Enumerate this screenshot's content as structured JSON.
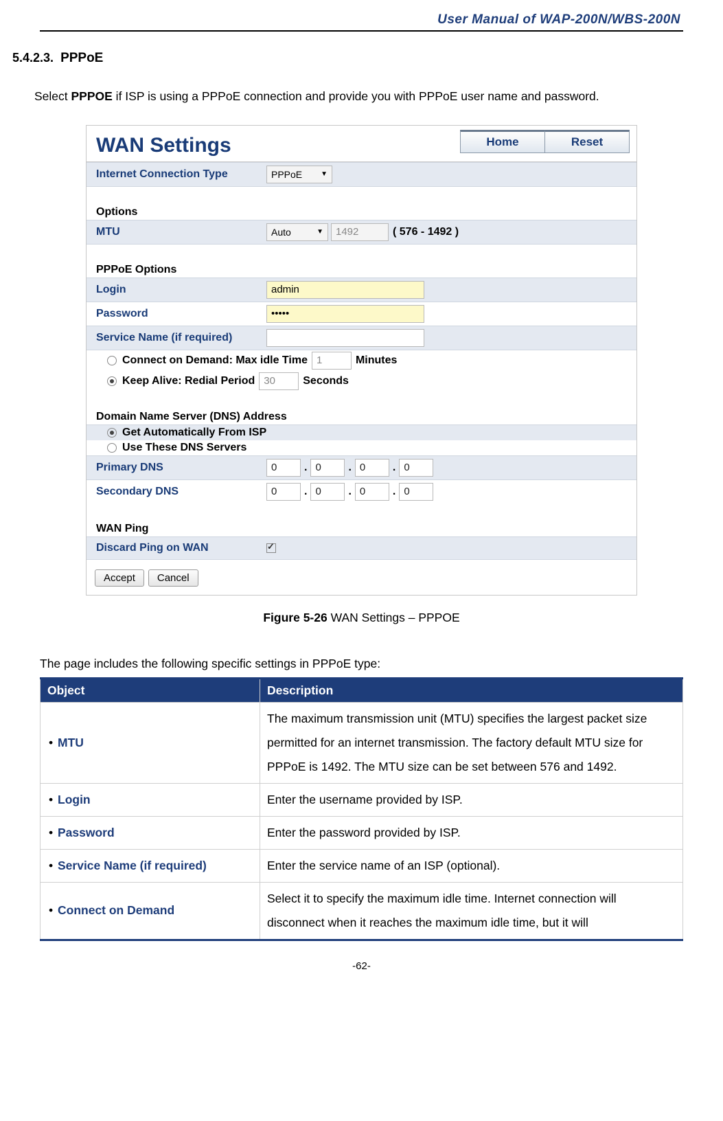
{
  "header": {
    "manual_title": "User Manual of WAP-200N/WBS-200N"
  },
  "section": {
    "number": "5.4.2.3.",
    "title": "PPPoE",
    "intro_pre": "Select ",
    "intro_bold": "PPPOE",
    "intro_post": " if ISP is using a PPPoE connection and provide you with PPPoE user name and password."
  },
  "shot": {
    "title": "WAN Settings",
    "home": "Home",
    "reset": "Reset",
    "ict_label": "Internet Connection Type",
    "ict_value": "PPPoE",
    "options_heading": "Options",
    "mtu_label": "MTU",
    "mtu_mode": "Auto",
    "mtu_value": "1492",
    "mtu_range": "( 576 - 1492 )",
    "pppoe_heading": "PPPoE Options",
    "login_label": "Login",
    "login_value": "admin",
    "password_label": "Password",
    "password_value": "•••••",
    "service_label": "Service Name (if required)",
    "service_value": "",
    "cod_label_pre": "Connect on Demand: Max idle Time",
    "cod_value": "1",
    "cod_label_post": "Minutes",
    "keep_label_pre": "Keep Alive: Redial Period",
    "keep_value": "30",
    "keep_label_post": "Seconds",
    "dns_heading": "Domain Name Server (DNS) Address",
    "dns_auto": "Get Automatically From ISP",
    "dns_manual": "Use These DNS Servers",
    "pdns_label": "Primary DNS",
    "sdns_label": "Secondary DNS",
    "dns_oct": "0",
    "wanping_heading": "WAN Ping",
    "discard_label": "Discard Ping on WAN",
    "accept": "Accept",
    "cancel": "Cancel"
  },
  "figure": {
    "bold": "Figure 5-26",
    "rest": " WAN Settings – PPPOE"
  },
  "table_intro": "The page includes the following specific settings in PPPoE type:",
  "table": {
    "h1": "Object",
    "h2": "Description",
    "rows": [
      {
        "obj": "MTU",
        "desc": "The maximum transmission unit (MTU) specifies the largest packet size permitted for an internet transmission. The factory default MTU size for PPPoE is 1492. The MTU size can be set between 576 and 1492."
      },
      {
        "obj": "Login",
        "desc": "Enter the username provided by ISP."
      },
      {
        "obj": "Password",
        "desc": "Enter the password provided by ISP."
      },
      {
        "obj": "Service Name (if required)",
        "desc": "Enter the service name of an ISP (optional)."
      },
      {
        "obj": "Connect on Demand",
        "desc": "Select it to specify the maximum idle time. Internet connection will disconnect when it reaches the maximum idle time, but it will"
      }
    ]
  },
  "page_number": "-62-"
}
